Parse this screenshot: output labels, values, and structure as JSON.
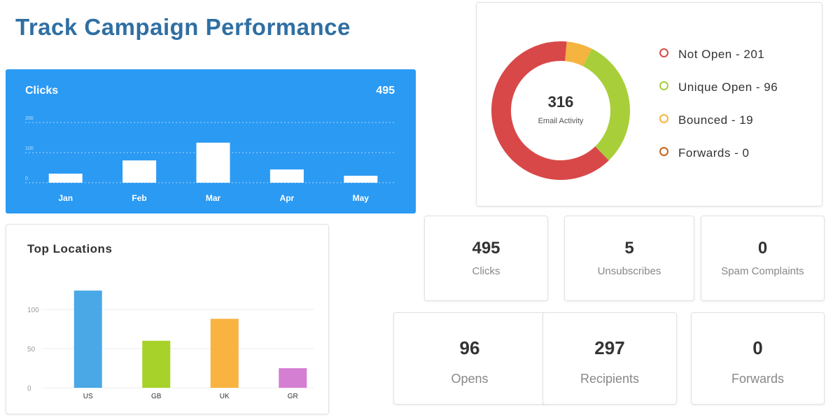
{
  "title": "Track Campaign Performance",
  "clicks_card": {
    "label": "Clicks",
    "total": "495"
  },
  "chart_data": [
    {
      "type": "bar",
      "title": "Clicks",
      "categories": [
        "Jan",
        "Feb",
        "Mar",
        "Apr",
        "May"
      ],
      "values": [
        30,
        74,
        133,
        44,
        23
      ],
      "yticks": [
        "0",
        "100",
        "200"
      ],
      "ylim": [
        0,
        200
      ],
      "grid": true,
      "color": "#ffffff"
    },
    {
      "type": "bar",
      "title": "Top Locations",
      "categories": [
        "US",
        "GB",
        "UK",
        "GR"
      ],
      "values": [
        124,
        60,
        88,
        25
      ],
      "colors": [
        "#4aa8e6",
        "#a6d22a",
        "#f8b340",
        "#d47fd2"
      ],
      "yticks": [
        "0",
        "50",
        "100"
      ],
      "ylim": [
        0,
        125
      ],
      "grid": true
    },
    {
      "type": "pie",
      "center_value": "316",
      "center_label": "Email Activity",
      "slices": [
        {
          "name": "Not Open",
          "value": 201,
          "color": "#d94848"
        },
        {
          "name": "Unique Open",
          "value": 96,
          "color": "#a8cf3a"
        },
        {
          "name": "Bounced",
          "value": 19,
          "color": "#f5b340"
        },
        {
          "name": "Forwards",
          "value": 0,
          "color": "#c0661a"
        }
      ]
    }
  ],
  "legend": [
    "Not Open - 201",
    "Unique Open - 96",
    "Bounced - 19",
    "Forwards - 0"
  ],
  "stats": [
    {
      "n": "495",
      "l": "Clicks"
    },
    {
      "n": "5",
      "l": "Unsubscribes"
    },
    {
      "n": "0",
      "l": "Spam Complaints"
    },
    {
      "n": "96",
      "l": "Opens"
    },
    {
      "n": "297",
      "l": "Recipients"
    },
    {
      "n": "0",
      "l": "Forwards"
    }
  ]
}
